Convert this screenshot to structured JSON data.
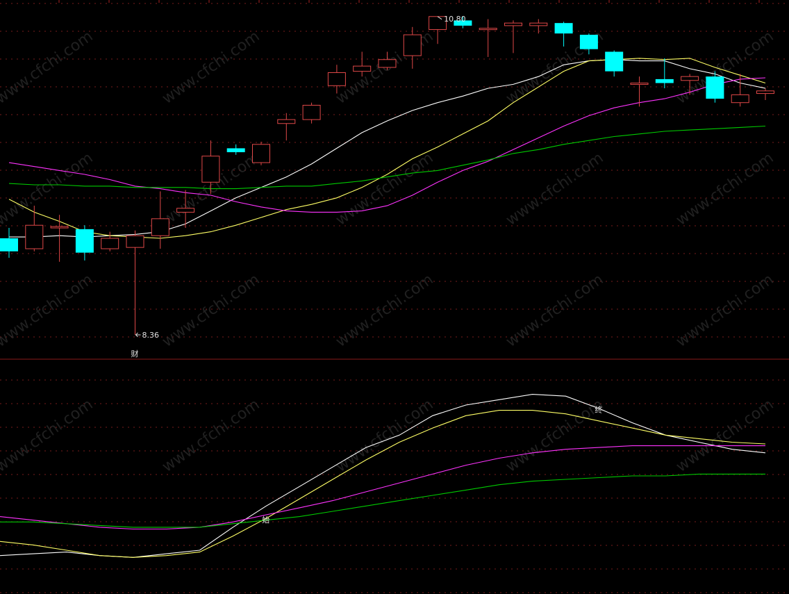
{
  "chart_data": [
    {
      "type": "candlestick",
      "title": "",
      "ylim": [
        8.2,
        10.9
      ],
      "up_color": "#e04848",
      "down_color": "#00ffff",
      "candles": [
        {
          "o": 9.1,
          "h": 9.18,
          "l": 8.95,
          "c": 9.0
        },
        {
          "o": 9.02,
          "h": 9.35,
          "l": 9.0,
          "c": 9.2
        },
        {
          "o": 9.19,
          "h": 9.28,
          "l": 8.92,
          "c": 9.19
        },
        {
          "o": 9.17,
          "h": 9.2,
          "l": 8.93,
          "c": 8.99
        },
        {
          "o": 9.02,
          "h": 9.15,
          "l": 9.0,
          "c": 9.1
        },
        {
          "o": 9.03,
          "h": 9.16,
          "l": 8.36,
          "c": 9.12
        },
        {
          "o": 9.12,
          "h": 9.46,
          "l": 9.02,
          "c": 9.25
        },
        {
          "o": 9.3,
          "h": 9.47,
          "l": 9.18,
          "c": 9.33
        },
        {
          "o": 9.53,
          "h": 9.85,
          "l": 9.44,
          "c": 9.73
        },
        {
          "o": 9.79,
          "h": 9.82,
          "l": 9.74,
          "c": 9.76
        },
        {
          "o": 9.68,
          "h": 9.84,
          "l": 9.66,
          "c": 9.82
        },
        {
          "o": 9.98,
          "h": 10.06,
          "l": 9.85,
          "c": 10.01
        },
        {
          "o": 10.01,
          "h": 10.14,
          "l": 9.98,
          "c": 10.12
        },
        {
          "o": 10.27,
          "h": 10.43,
          "l": 10.21,
          "c": 10.37
        },
        {
          "o": 10.38,
          "h": 10.53,
          "l": 10.34,
          "c": 10.42
        },
        {
          "o": 10.41,
          "h": 10.53,
          "l": 10.39,
          "c": 10.47
        },
        {
          "o": 10.5,
          "h": 10.72,
          "l": 10.4,
          "c": 10.66
        },
        {
          "o": 10.7,
          "h": 10.78,
          "l": 10.59,
          "c": 10.8
        },
        {
          "o": 10.77,
          "h": 10.8,
          "l": 10.71,
          "c": 10.73
        },
        {
          "o": 10.7,
          "h": 10.78,
          "l": 10.49,
          "c": 10.71
        },
        {
          "o": 10.73,
          "h": 10.77,
          "l": 10.52,
          "c": 10.75
        },
        {
          "o": 10.73,
          "h": 10.78,
          "l": 10.67,
          "c": 10.75
        },
        {
          "o": 10.75,
          "h": 10.76,
          "l": 10.57,
          "c": 10.67
        },
        {
          "o": 10.66,
          "h": 10.67,
          "l": 10.51,
          "c": 10.55
        },
        {
          "o": 10.53,
          "h": 10.54,
          "l": 10.34,
          "c": 10.38
        },
        {
          "o": 10.28,
          "h": 10.34,
          "l": 10.11,
          "c": 10.29
        },
        {
          "o": 10.32,
          "h": 10.48,
          "l": 10.25,
          "c": 10.29
        },
        {
          "o": 10.31,
          "h": 10.36,
          "l": 10.2,
          "c": 10.34
        },
        {
          "o": 10.34,
          "h": 10.38,
          "l": 10.14,
          "c": 10.17
        },
        {
          "o": 10.14,
          "h": 10.36,
          "l": 10.11,
          "c": 10.2
        },
        {
          "o": 10.21,
          "h": 10.25,
          "l": 10.16,
          "c": 10.23
        }
      ],
      "moving_averages": [
        {
          "color": "#ffffff",
          "values": [
            9.11,
            9.11,
            9.12,
            9.11,
            9.12,
            9.13,
            9.15,
            9.21,
            9.31,
            9.41,
            9.49,
            9.57,
            9.67,
            9.79,
            9.91,
            10.0,
            10.08,
            10.14,
            10.19,
            10.25,
            10.28,
            10.34,
            10.43,
            10.46,
            10.47,
            10.46,
            10.46,
            10.4,
            10.36,
            10.29,
            10.25
          ]
        },
        {
          "color": "#ffff66",
          "values": [
            9.4,
            9.3,
            9.23,
            9.15,
            9.12,
            9.11,
            9.1,
            9.12,
            9.15,
            9.2,
            9.26,
            9.32,
            9.36,
            9.41,
            9.49,
            9.59,
            9.71,
            9.8,
            9.9,
            10.0,
            10.14,
            10.26,
            10.38,
            10.46,
            10.47,
            10.48,
            10.47,
            10.48,
            10.41,
            10.35,
            10.29
          ]
        },
        {
          "color": "#ff33ff",
          "values": [
            9.68,
            9.65,
            9.62,
            9.59,
            9.55,
            9.5,
            9.48,
            9.45,
            9.43,
            9.38,
            9.34,
            9.31,
            9.3,
            9.3,
            9.31,
            9.35,
            9.43,
            9.53,
            9.62,
            9.69,
            9.78,
            9.87,
            9.96,
            10.04,
            10.1,
            10.14,
            10.17,
            10.22,
            10.28,
            10.32,
            10.33
          ]
        },
        {
          "color": "#00cc00",
          "values": [
            9.52,
            9.51,
            9.51,
            9.5,
            9.5,
            9.49,
            9.49,
            9.49,
            9.48,
            9.48,
            9.49,
            9.5,
            9.5,
            9.52,
            9.54,
            9.57,
            9.6,
            9.62,
            9.66,
            9.7,
            9.75,
            9.78,
            9.82,
            9.85,
            9.88,
            9.9,
            9.92,
            9.93,
            9.94,
            9.95,
            9.96
          ]
        }
      ],
      "annotations": [
        {
          "text": "10.80",
          "index": 17,
          "value": 10.8,
          "kind": "high"
        },
        {
          "text": "8.36",
          "index": 5,
          "value": 8.36,
          "kind": "low"
        },
        {
          "text": "财",
          "index": 5,
          "kind": "event"
        }
      ]
    },
    {
      "type": "line",
      "title": "",
      "ylim": [
        0,
        100
      ],
      "series": [
        {
          "color": "#ffffff",
          "values": [
            6,
            7,
            8,
            6,
            5,
            7,
            9,
            22,
            34,
            45,
            56,
            67,
            74,
            85,
            91,
            94,
            97,
            96,
            89,
            81,
            74,
            70,
            66,
            64
          ]
        },
        {
          "color": "#ffff66",
          "values": [
            14,
            12,
            9,
            6,
            5,
            6,
            8,
            17,
            27,
            38,
            49,
            60,
            70,
            78,
            85,
            88,
            88,
            86,
            82,
            78,
            74,
            72,
            70,
            69
          ]
        },
        {
          "color": "#ff33ff",
          "values": [
            28,
            26,
            24,
            22,
            21,
            21,
            22,
            25,
            29,
            33,
            37,
            42,
            47,
            52,
            57,
            61,
            64,
            66,
            67,
            68,
            68,
            68,
            68,
            68
          ]
        },
        {
          "color": "#00cc00",
          "values": [
            25,
            25,
            24,
            23,
            22,
            22,
            22,
            24,
            26,
            28,
            31,
            34,
            37,
            40,
            43,
            46,
            48,
            49,
            50,
            51,
            51,
            52,
            52,
            52
          ]
        }
      ],
      "annotations": [
        {
          "text": "始",
          "index": 8,
          "value": 24
        },
        {
          "text": "终",
          "index": 18,
          "value": 86
        }
      ]
    }
  ],
  "watermark": {
    "text": "www.cfchi.com"
  }
}
